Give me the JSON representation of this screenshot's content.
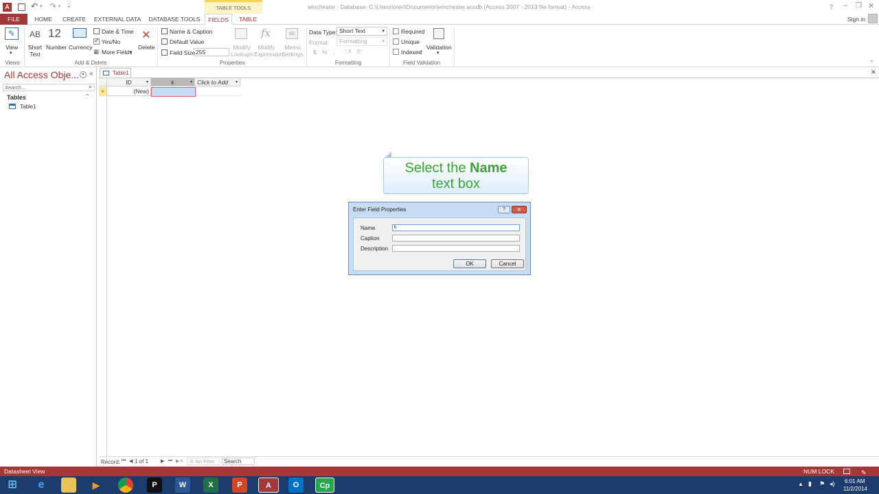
{
  "window": {
    "title": "winchester : Database- C:\\Users\\meri\\Documents\\winchester.accdb (Access 2007 - 2013 file format) - Access",
    "context_tab_group": "TABLE TOOLS",
    "help": "?",
    "sign_in": "Sign in"
  },
  "tabs": [
    {
      "label": "FILE"
    },
    {
      "label": "HOME"
    },
    {
      "label": "CREATE"
    },
    {
      "label": "EXTERNAL DATA"
    },
    {
      "label": "DATABASE TOOLS"
    },
    {
      "label": "FIELDS"
    },
    {
      "label": "TABLE"
    }
  ],
  "ribbon": {
    "views": {
      "view_label": "View",
      "group": "Views"
    },
    "add_delete": {
      "short_text_icon": "AB",
      "short_text": "Short Text",
      "number_icon": "12",
      "number": "Number",
      "currency": "Currency",
      "date_time": "Date & Time",
      "yes_no": "Yes/No",
      "more_fields": "More Fields",
      "delete": "Delete",
      "group": "Add & Delete"
    },
    "properties": {
      "name_caption": "Name & Caption",
      "default_value": "Default Value",
      "field_size_label": "Field Size",
      "field_size_value": "255",
      "modify_lookups": "Modify Lookups",
      "modify_expression": "Modify Expression",
      "memo_settings": "Memo Settings",
      "group": "Properties"
    },
    "formatting": {
      "data_type_label": "Data Type:",
      "data_type_value": "Short Text",
      "format_label": "Format:",
      "format_value": "Formatting",
      "group": "Formatting"
    },
    "validation": {
      "required": "Required",
      "unique": "Unique",
      "indexed": "Indexed",
      "validation": "Validation",
      "group": "Field Validation"
    }
  },
  "nav": {
    "title": "All Access Obje...",
    "search_placeholder": "Search...",
    "section": "Tables",
    "items": [
      {
        "label": "Table1"
      }
    ]
  },
  "document": {
    "tab": "Table1",
    "columns": [
      {
        "label": "ID"
      },
      {
        "label": "k"
      },
      {
        "label": "Click to Add"
      }
    ],
    "new_row_label": "(New)"
  },
  "callout": {
    "line1_prefix": "Select the ",
    "line1_bold": "Name",
    "line2": "text box"
  },
  "dialog": {
    "title": "Enter Field Properties",
    "help": "?",
    "fields": [
      {
        "label": "Name",
        "value": "k"
      },
      {
        "label": "Caption",
        "value": ""
      },
      {
        "label": "Description",
        "value": ""
      }
    ],
    "ok": "OK",
    "cancel": "Cancel"
  },
  "record_nav": {
    "label": "Record:",
    "position": "1 of 1",
    "filter": "No Filter",
    "search": "Search"
  },
  "status": {
    "left": "Datasheet View",
    "num_lock": "NUM LOCK"
  },
  "taskbar": {
    "apps": [
      {
        "icon": "windows-icon"
      },
      {
        "icon": "ie-icon"
      },
      {
        "icon": "folder-icon"
      },
      {
        "icon": "media-icon"
      },
      {
        "icon": "chrome-icon"
      },
      {
        "icon": "P"
      },
      {
        "icon": "W"
      },
      {
        "icon": "X"
      },
      {
        "icon": "P"
      },
      {
        "icon": "A"
      },
      {
        "icon": "O"
      },
      {
        "icon": "Cp"
      }
    ],
    "time": "6:01 AM",
    "date": "11/2/2014"
  },
  "colors": {
    "access_red": "#a4373a",
    "context_tab_yellow": "#f5d55a",
    "callout_green": "#3aa434",
    "taskbar": "#1c3c6d"
  }
}
